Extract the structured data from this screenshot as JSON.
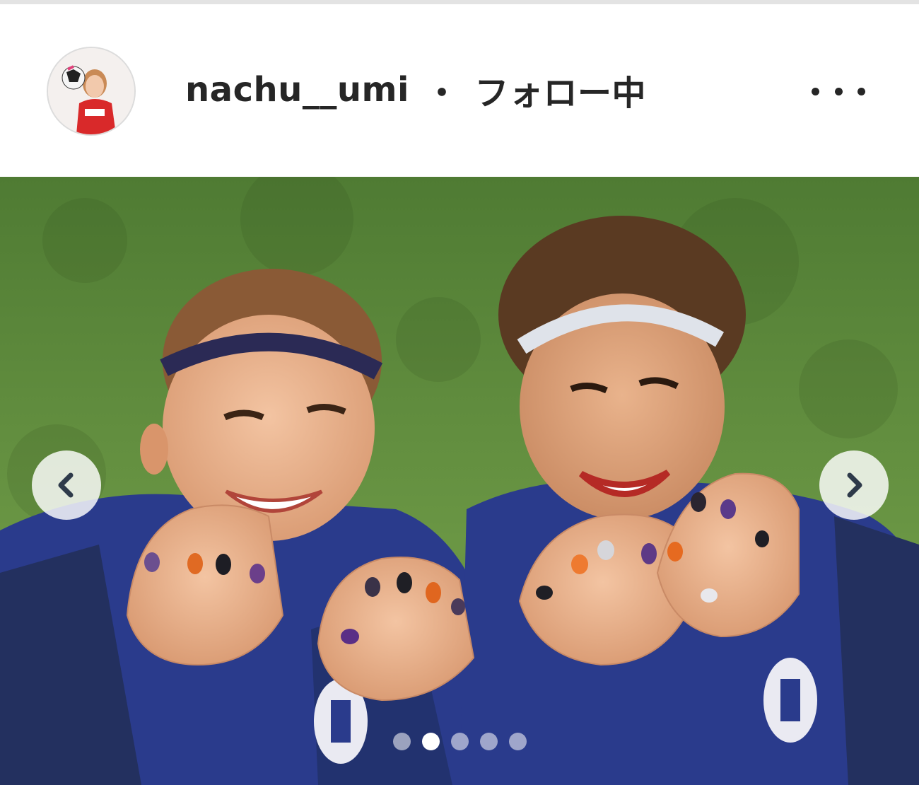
{
  "header": {
    "username": "nachu__umi",
    "separator": "・",
    "follow_status": "フォロー中",
    "avatar_icon": "profile-avatar",
    "more_icon": "more-options-icon"
  },
  "post": {
    "prev_icon": "chevron-left-icon",
    "next_icon": "chevron-right-icon",
    "carousel_count": 5,
    "carousel_active_index": 1
  },
  "colors": {
    "text": "#262626",
    "grass": "#5f8a3f",
    "jersey": "#2a3e93",
    "arrow": "#2e3a4a"
  }
}
